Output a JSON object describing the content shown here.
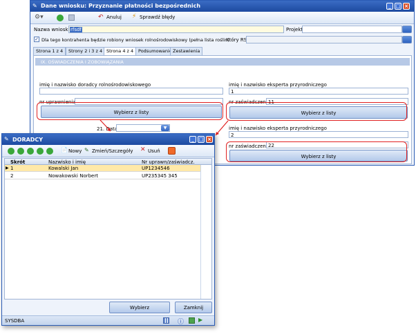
{
  "main": {
    "title": "Dane wniosku: Przyznanie płatności bezpośrednich",
    "toolbar": {
      "undo_label": "Anuluj",
      "check_label": "Sprawdź błędy"
    },
    "fields": {
      "nazwa_label": "Nazwa wniosku",
      "nazwa_value": "rfsdf",
      "projekt_label": "Projekt",
      "checkbox_label": "Dla tego kontrahenta będzie robiony wniosek rolnośrodowiskowy (pełna lista roślin)",
      "ktory_rs_label": "Który RS"
    },
    "tabs": [
      "Strona 1 z 4",
      "Strony 2 i 3 z 4",
      "Strona 4 z 4",
      "Podsumowanie",
      "Zestawienia"
    ],
    "section_header": "IX. OŚWIADCZENIA I ZOBOWIĄZANIA",
    "left": {
      "doradca_label": "imię i nazwisko doradcy rolnośrodowiskowego",
      "nr_label": "nr uprawnienia",
      "select_button": "Wybierz z listy",
      "data_label": "21. Data"
    },
    "right": {
      "ekspert1_label": "imię i nazwisko eksperta przyrodniczego",
      "ekspert1_value": "1",
      "nr1_label": "nr zaświadczenia",
      "nr1_value": "11",
      "select_button1": "Wybierz z listy",
      "ekspert2_label": "imię i nazwisko eksperta przyrodniczego",
      "ekspert2_value": "2",
      "nr2_label": "nr zaświadczenia",
      "nr2_value": "22",
      "select_button2": "Wybierz z listy"
    }
  },
  "dialog": {
    "title": "DORADCY",
    "toolbar": {
      "new_label": "Nowy",
      "edit_label": "Zmień/Szczegóły",
      "delete_label": "Usuń"
    },
    "columns": [
      "Skrót",
      "Nazwisko i imię",
      "Nr uprawn/zaświadcz."
    ],
    "rows": [
      {
        "skrot": "1",
        "nazwisko": "Kowalski Jan",
        "nr": "UP1234546"
      },
      {
        "skrot": "2",
        "nazwisko": "Nowakowski Norbert",
        "nr": "UP235345 345"
      }
    ],
    "select_button": "Wybierz",
    "close_button": "Zamknij",
    "status_user": "SYSDBA"
  },
  "colors": {
    "accent": "#1d4aa0",
    "highlight_border": "#e02020",
    "selected_row": "#ffe9a8"
  }
}
